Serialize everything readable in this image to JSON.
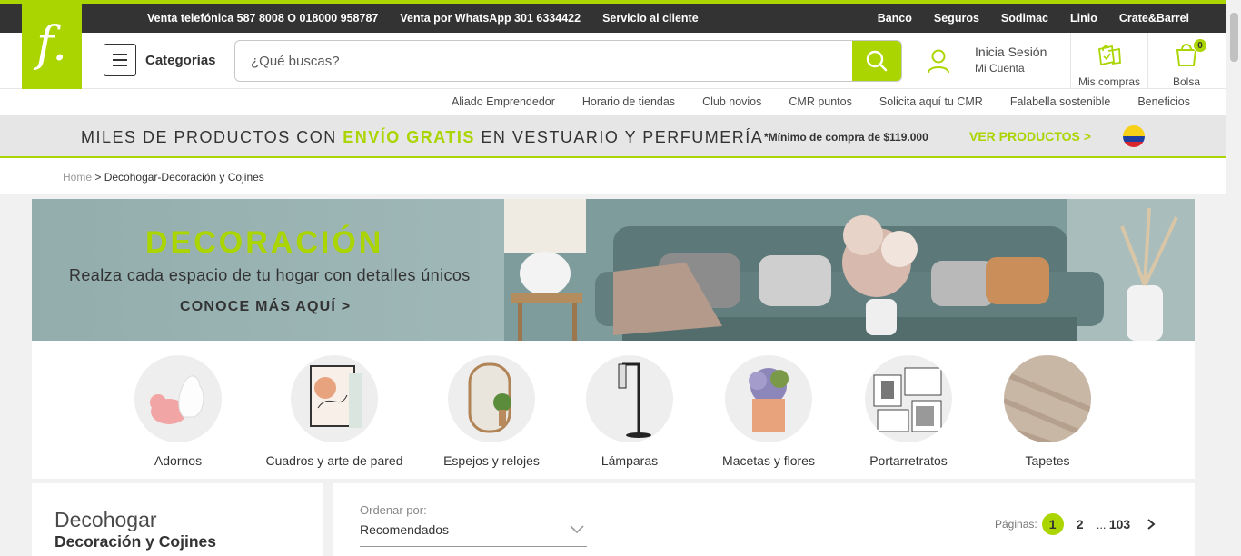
{
  "topbar": {
    "left": [
      "Venta telefónica 587 8008 O 018000 958787",
      "Venta por WhatsApp 301 6334422",
      "Servicio al cliente"
    ],
    "right": [
      "Banco",
      "Seguros",
      "Sodimac",
      "Linio",
      "Crate&Barrel"
    ]
  },
  "logo": {
    "glyph": "f."
  },
  "header": {
    "categories_label": "Categorías",
    "search_placeholder": "¿Qué buscas?",
    "login_line1": "Inicia Sesión",
    "login_line2": "Mi Cuenta",
    "purchases_label": "Mis compras",
    "bag_label": "Bolsa",
    "bag_count": "0"
  },
  "subnav": [
    "Aliado Emprendedor",
    "Horario de tiendas",
    "Club novios",
    "CMR puntos",
    "Solicita aquí tu CMR",
    "Falabella sostenible",
    "Beneficios"
  ],
  "promo": {
    "text_a": "MILES DE PRODUCTOS CON ",
    "text_b": "ENVÍO GRATIS",
    "text_c": " EN VESTUARIO Y PERFUMERÍA",
    "note": "*Mínimo de compra de $119.000",
    "cta": "VER PRODUCTOS >"
  },
  "breadcrumb": {
    "home": "Home",
    "sep": " > ",
    "current": "Decohogar-Decoración y Cojines"
  },
  "banner": {
    "title": "DECORACIÓN",
    "subtitle": "Realza cada espacio de tu hogar con detalles únicos",
    "cta": "CONOCE MÁS AQUÍ  >"
  },
  "categories": [
    {
      "label": "Adornos"
    },
    {
      "label": "Cuadros y arte de pared"
    },
    {
      "label": "Espejos y relojes"
    },
    {
      "label": "Lámparas"
    },
    {
      "label": "Macetas y flores"
    },
    {
      "label": "Portarretratos"
    },
    {
      "label": "Tapetes"
    }
  ],
  "sidebar": {
    "title": "Decohogar",
    "subtitle": "Decoración y Cojines"
  },
  "sort": {
    "label": "Ordenar por:",
    "value": "Recomendados"
  },
  "pagination": {
    "label": "Páginas:",
    "p1": "1",
    "p2": "2",
    "dots": "...",
    "last": "103"
  },
  "colors": {
    "brand": "#aad500",
    "topbar": "#333333"
  }
}
